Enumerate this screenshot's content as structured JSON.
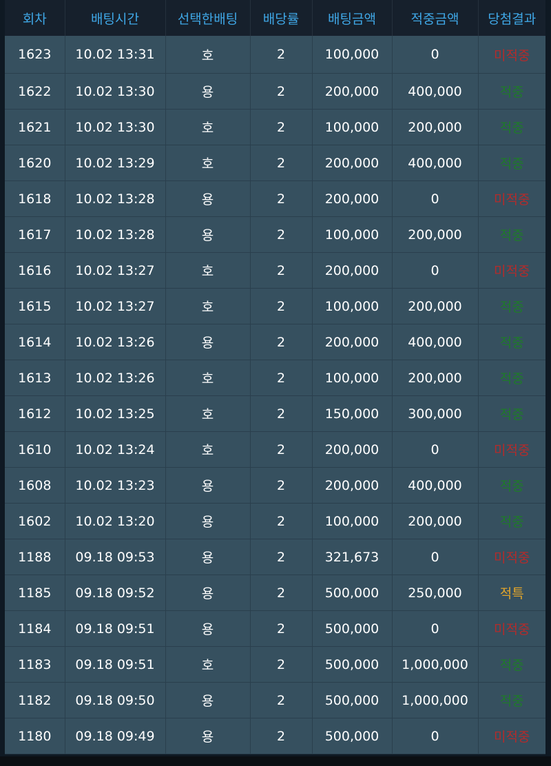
{
  "headers": [
    "회차",
    "배팅시간",
    "선택한배팅",
    "배당률",
    "배팅금액",
    "적중금액",
    "당첨결과"
  ],
  "colors": {
    "header_bg": "#16202c",
    "header_text": "#3fa7e6",
    "row_bg": "#36505f",
    "row_text": "#ffffff",
    "result_miss": "#b32b2b",
    "result_hit": "#1f7a2a",
    "result_special": "#e2a52a"
  },
  "rows": [
    {
      "round": "1623",
      "time": "10.02 13:31",
      "pick": "호",
      "odds": "2",
      "bet": "100,000",
      "win": "0",
      "result": "미적중",
      "status": "miss"
    },
    {
      "round": "1622",
      "time": "10.02 13:30",
      "pick": "용",
      "odds": "2",
      "bet": "200,000",
      "win": "400,000",
      "result": "적중",
      "status": "hit"
    },
    {
      "round": "1621",
      "time": "10.02 13:30",
      "pick": "호",
      "odds": "2",
      "bet": "100,000",
      "win": "200,000",
      "result": "적중",
      "status": "hit"
    },
    {
      "round": "1620",
      "time": "10.02 13:29",
      "pick": "호",
      "odds": "2",
      "bet": "200,000",
      "win": "400,000",
      "result": "적중",
      "status": "hit"
    },
    {
      "round": "1618",
      "time": "10.02 13:28",
      "pick": "용",
      "odds": "2",
      "bet": "200,000",
      "win": "0",
      "result": "미적중",
      "status": "miss"
    },
    {
      "round": "1617",
      "time": "10.02 13:28",
      "pick": "용",
      "odds": "2",
      "bet": "100,000",
      "win": "200,000",
      "result": "적중",
      "status": "hit"
    },
    {
      "round": "1616",
      "time": "10.02 13:27",
      "pick": "호",
      "odds": "2",
      "bet": "200,000",
      "win": "0",
      "result": "미적중",
      "status": "miss"
    },
    {
      "round": "1615",
      "time": "10.02 13:27",
      "pick": "호",
      "odds": "2",
      "bet": "100,000",
      "win": "200,000",
      "result": "적중",
      "status": "hit"
    },
    {
      "round": "1614",
      "time": "10.02 13:26",
      "pick": "용",
      "odds": "2",
      "bet": "200,000",
      "win": "400,000",
      "result": "적중",
      "status": "hit"
    },
    {
      "round": "1613",
      "time": "10.02 13:26",
      "pick": "호",
      "odds": "2",
      "bet": "100,000",
      "win": "200,000",
      "result": "적중",
      "status": "hit"
    },
    {
      "round": "1612",
      "time": "10.02 13:25",
      "pick": "호",
      "odds": "2",
      "bet": "150,000",
      "win": "300,000",
      "result": "적중",
      "status": "hit"
    },
    {
      "round": "1610",
      "time": "10.02 13:24",
      "pick": "호",
      "odds": "2",
      "bet": "200,000",
      "win": "0",
      "result": "미적중",
      "status": "miss"
    },
    {
      "round": "1608",
      "time": "10.02 13:23",
      "pick": "용",
      "odds": "2",
      "bet": "200,000",
      "win": "400,000",
      "result": "적중",
      "status": "hit"
    },
    {
      "round": "1602",
      "time": "10.02 13:20",
      "pick": "용",
      "odds": "2",
      "bet": "100,000",
      "win": "200,000",
      "result": "적중",
      "status": "hit"
    },
    {
      "round": "1188",
      "time": "09.18 09:53",
      "pick": "용",
      "odds": "2",
      "bet": "321,673",
      "win": "0",
      "result": "미적중",
      "status": "miss"
    },
    {
      "round": "1185",
      "time": "09.18 09:52",
      "pick": "용",
      "odds": "2",
      "bet": "500,000",
      "win": "250,000",
      "result": "적특",
      "status": "special"
    },
    {
      "round": "1184",
      "time": "09.18 09:51",
      "pick": "용",
      "odds": "2",
      "bet": "500,000",
      "win": "0",
      "result": "미적중",
      "status": "miss"
    },
    {
      "round": "1183",
      "time": "09.18 09:51",
      "pick": "호",
      "odds": "2",
      "bet": "500,000",
      "win": "1,000,000",
      "result": "적중",
      "status": "hit"
    },
    {
      "round": "1182",
      "time": "09.18 09:50",
      "pick": "용",
      "odds": "2",
      "bet": "500,000",
      "win": "1,000,000",
      "result": "적중",
      "status": "hit"
    },
    {
      "round": "1180",
      "time": "09.18 09:49",
      "pick": "용",
      "odds": "2",
      "bet": "500,000",
      "win": "0",
      "result": "미적중",
      "status": "miss"
    }
  ]
}
